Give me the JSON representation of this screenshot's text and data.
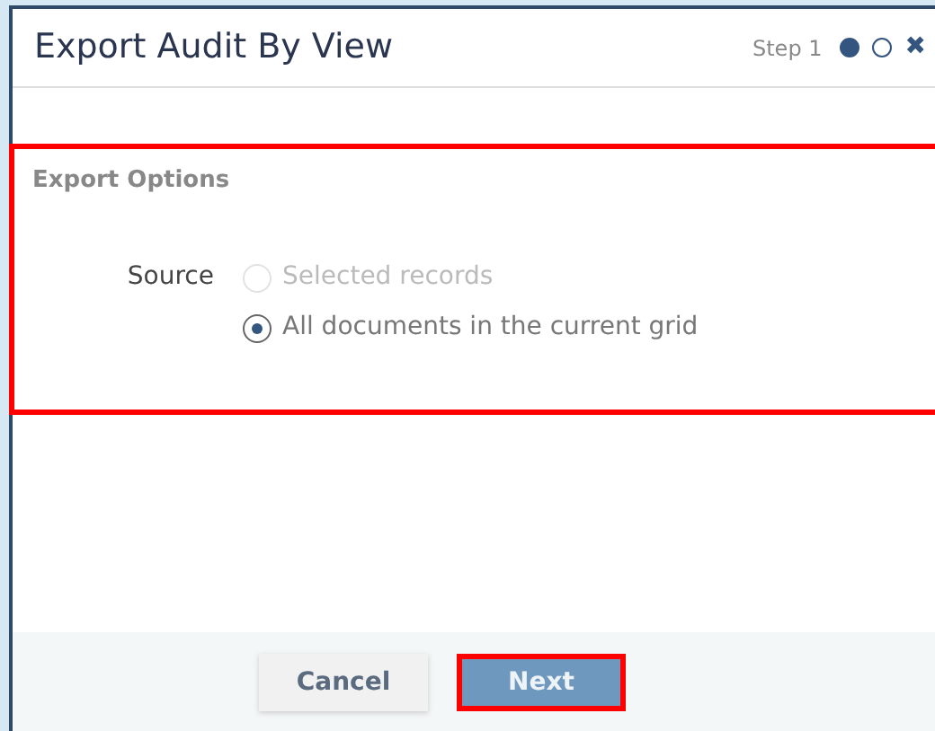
{
  "dialog": {
    "title": "Export Audit By View",
    "step_label": "Step 1",
    "steps": [
      {
        "selected": true
      },
      {
        "selected": false
      }
    ],
    "close": "✖"
  },
  "section": {
    "title": "Export Options",
    "highlighted": true,
    "field_label": "Source",
    "options": [
      {
        "label": "Selected records",
        "selected": false,
        "disabled": true
      },
      {
        "label": "All documents in the current grid",
        "selected": true,
        "disabled": false
      }
    ]
  },
  "buttons": [
    {
      "label": "Cancel",
      "kind": "secondary",
      "highlighted": false
    },
    {
      "label": "Next",
      "kind": "primary",
      "highlighted": true
    }
  ]
}
